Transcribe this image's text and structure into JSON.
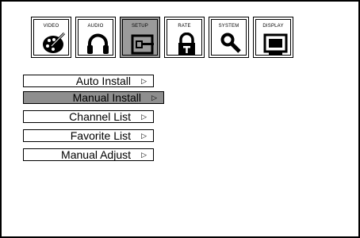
{
  "tabs": [
    {
      "label": "VIDEO",
      "icon": "palette-icon",
      "active": false
    },
    {
      "label": "AUDIO",
      "icon": "headphones-icon",
      "active": false
    },
    {
      "label": "SETUP",
      "icon": "input-plug-icon",
      "active": true
    },
    {
      "label": "RATE",
      "icon": "lock-icon",
      "active": false
    },
    {
      "label": "SYSTEM",
      "icon": "magnifier-icon",
      "active": false
    },
    {
      "label": "DISPLAY",
      "icon": "monitor-icon",
      "active": false
    }
  ],
  "menu": {
    "items": [
      {
        "label": "Auto Install",
        "arrow": "▷",
        "active": false
      },
      {
        "label": "Manual Install",
        "arrow": "▷",
        "active": true
      },
      {
        "label": "Channel List",
        "arrow": "▷",
        "active": false
      },
      {
        "label": "Favorite List",
        "arrow": "▷",
        "active": false
      },
      {
        "label": "Manual Adjust",
        "arrow": "▷",
        "active": false
      }
    ]
  },
  "colors": {
    "active_tab": "#9b9b9b",
    "active_item": "#8e8e8e",
    "background": "#ffffff",
    "border": "#000000"
  }
}
